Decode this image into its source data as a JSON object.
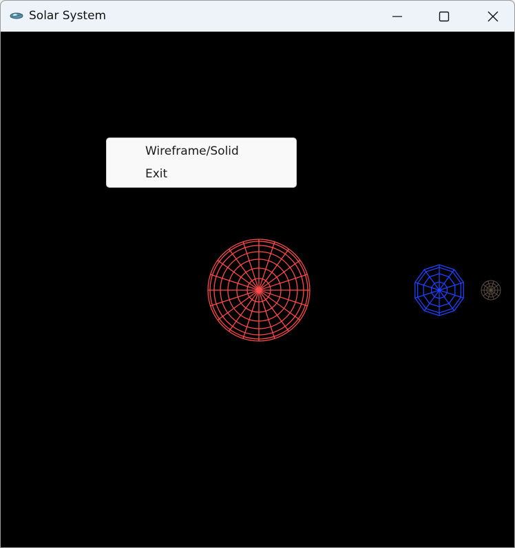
{
  "window": {
    "title": "Solar System",
    "app_icon": "satellite-icon",
    "controls": {
      "minimize": "minimize-icon",
      "maximize": "maximize-icon",
      "close": "close-icon"
    }
  },
  "context_menu": {
    "items": [
      {
        "label": "Wireframe/Solid"
      },
      {
        "label": "Exit"
      }
    ]
  },
  "scene": {
    "background": "#000000",
    "bodies": [
      {
        "name": "sun",
        "color": "#ff4a4a"
      },
      {
        "name": "earth",
        "color": "#1f3cff"
      },
      {
        "name": "moon",
        "color": "#6a5a4a"
      }
    ]
  }
}
